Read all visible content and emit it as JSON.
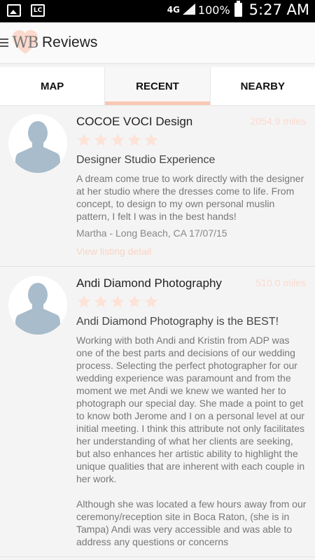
{
  "status_bar": {
    "left_icons": [
      "photo-icon",
      "lc-icon"
    ],
    "lc_label": "LC",
    "network": "4G",
    "battery_percent": "100%",
    "time": "5:27 AM"
  },
  "header": {
    "logo_text": "WB",
    "title": "Reviews"
  },
  "tabs": [
    {
      "label": "MAP",
      "active": false
    },
    {
      "label": "RECENT",
      "active": true
    },
    {
      "label": "NEARBY",
      "active": false
    }
  ],
  "colors": {
    "accent": "#f9c7b3",
    "star": "#fde2d8",
    "avatar": "#a8bccb"
  },
  "reviews": [
    {
      "name": "COCOE VOCI Design",
      "distance": "2054.9 miles",
      "stars": 5,
      "title": "Designer Studio Experience",
      "body": "A dream come true to work directly with the designer at her studio where the dresses come to life. From concept, to design to my own personal muslin pattern, I felt I was in the best hands!",
      "meta": "Martha - Long Beach, CA 17/07/15",
      "link": "View listing detail"
    },
    {
      "name": "Andi Diamond Photography",
      "distance": "510.0 miles",
      "stars": 5,
      "title": "Andi Diamond Photography is the BEST!",
      "body": "Working with both Andi and Kristin from ADP was one of the best parts and decisions of our wedding process.  Selecting the perfect photographer for our wedding experience was paramount and from the moment we met Andi we knew we wanted her to photograph our special day.  She made a point to get to know both Jerome and I on a personal level at our initial meeting.  I think this attribute not only facilitates her understanding of what her clients are seeking, but also enhances her artistic ability to highlight the unique qualities that are inherent with each couple in her work.\n\nAlthough she was located a few hours away from our ceremony/reception site in Boca Raton, (she is in Tampa) Andi was very accessible and was able to address any questions or concerns"
    }
  ]
}
